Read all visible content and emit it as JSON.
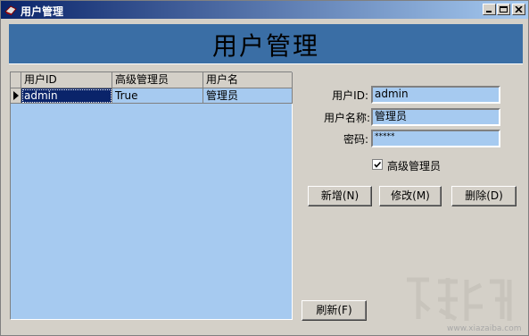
{
  "window": {
    "title": "用户管理"
  },
  "banner": {
    "title": "用户管理"
  },
  "grid": {
    "columns": [
      "用户ID",
      "高级管理员",
      "用户名"
    ],
    "rows": [
      [
        "admin",
        "True",
        "管理员"
      ]
    ]
  },
  "form": {
    "user_id_label": "用户ID:",
    "user_id_value": "admin",
    "user_name_label": "用户名称:",
    "user_name_value": "管理员",
    "password_label": "密码:",
    "password_value": "*****",
    "admin_checkbox_label": "高级管理员",
    "admin_checked": true
  },
  "buttons": {
    "add": "新增(N)",
    "edit": "修改(M)",
    "delete": "删除(D)",
    "refresh": "刷新(F)"
  },
  "watermark": {
    "text": "www.xiazaiba.com"
  }
}
